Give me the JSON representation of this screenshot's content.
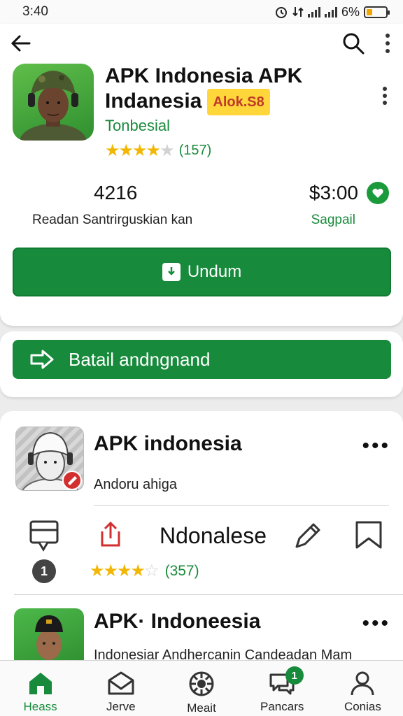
{
  "status_bar": {
    "time": "3:40",
    "battery": "6%"
  },
  "app": {
    "title_line1": "APK Indonesia APK",
    "title_line2": "Indanesia",
    "badge": "Alok.S8",
    "developer": "Tonbesial",
    "rating_stars": 4,
    "rating_count": "(157)",
    "stat_number": "4216",
    "stat_label": "Readan Santrirguskian kan",
    "price": "$3:00",
    "price_label": "Sagpail",
    "install_label": "Undum",
    "detail_label": "Batail andngnand"
  },
  "list": [
    {
      "title": "APK indonesia",
      "subtitle": "Andoru ahiga",
      "action_label": "Ndonalese",
      "badge_count": "1",
      "rating_stars": 4,
      "rating_count": "(357)"
    },
    {
      "title": "APK· Indoneesia",
      "subtitle": "Indonesiar Andhercanin Candeadan Mam"
    }
  ],
  "bottom_nav": [
    {
      "label": "Heass",
      "icon": "home-icon",
      "active": true
    },
    {
      "label": "Jerve",
      "icon": "mail-icon",
      "active": false
    },
    {
      "label": "Meait",
      "icon": "gear-wheel-icon",
      "active": false
    },
    {
      "label": "Pancars",
      "icon": "chat-bubbles-icon",
      "active": false,
      "badge": "1"
    },
    {
      "label": "Conias",
      "icon": "person-icon",
      "active": false
    }
  ],
  "colors": {
    "accent": "#178a3c",
    "star": "#f2b705",
    "badge_yellow": "#ffd73a"
  }
}
